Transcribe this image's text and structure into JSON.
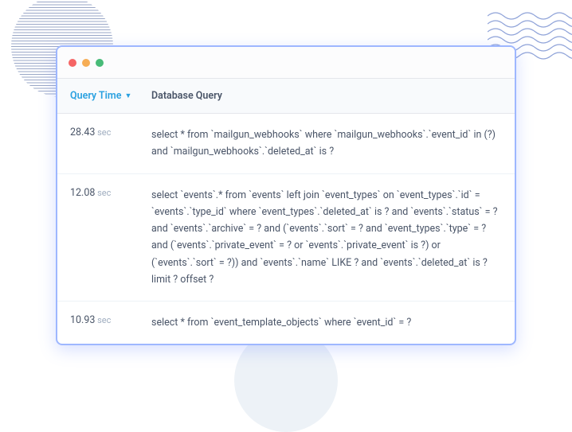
{
  "colors": {
    "accent": "#2aa1e0",
    "border": "#9eb7ff"
  },
  "table": {
    "headers": {
      "query_time": "Query Time",
      "database_query": "Database Query"
    },
    "rows": [
      {
        "time_value": "28.43",
        "time_unit": "sec",
        "query": "select * from `mailgun_webhooks` where `mailgun_webhooks`.`event_id` in (?) and `mailgun_webhooks`.`deleted_at` is ?"
      },
      {
        "time_value": "12.08",
        "time_unit": "sec",
        "query": "select `events`.* from `events` left join `event_types` on `event_types`.`id` = `events`.`type_id` where `event_types`.`deleted_at` is ? and `events`.`status` = ? and `events`.`archive` = ? and (`events`.`sort` = ? and `event_types`.`type` = ? and (`events`.`private_event` = ? or `events`.`private_event` is ?) or (`events`.`sort` = ?)) and `events`.`name` LIKE ? and `events`.`deleted_at` is ? limit ? offset ?"
      },
      {
        "time_value": "10.93",
        "time_unit": "sec",
        "query": "select * from `event_template_objects` where `event_id` = ?"
      }
    ]
  }
}
